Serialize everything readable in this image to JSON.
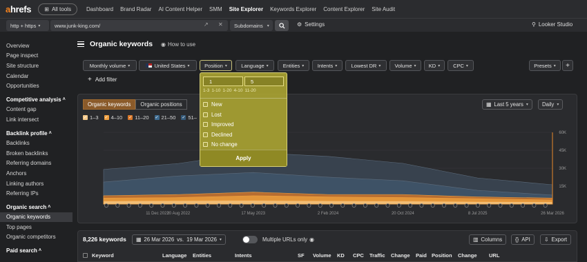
{
  "nav": {
    "logo_a": "a",
    "logo_rest": "hrefs",
    "all_tools": "All tools",
    "links": [
      "Dashboard",
      "Brand Radar",
      "AI Content Helper",
      "SMM",
      "Site Explorer",
      "Keywords Explorer",
      "Content Explorer",
      "Site Audit"
    ],
    "active": "Site Explorer"
  },
  "urlbar": {
    "protocol": "http + https",
    "url": "www.junk-king.com/",
    "mode": "Subdomains",
    "settings": "Settings",
    "looker": "Looker Studio"
  },
  "sidebar": {
    "items": [
      {
        "label": "Overview",
        "type": "item"
      },
      {
        "label": "Page inspect",
        "type": "item"
      },
      {
        "label": "Site structure",
        "type": "item"
      },
      {
        "label": "Calendar",
        "type": "item"
      },
      {
        "label": "Opportunities",
        "type": "item"
      },
      {
        "label": "Competitive analysis",
        "type": "head"
      },
      {
        "label": "Content gap",
        "type": "item"
      },
      {
        "label": "Link intersect",
        "type": "item"
      },
      {
        "label": "Backlink profile",
        "type": "head"
      },
      {
        "label": "Backlinks",
        "type": "item"
      },
      {
        "label": "Broken backlinks",
        "type": "item"
      },
      {
        "label": "Referring domains",
        "type": "item"
      },
      {
        "label": "Anchors",
        "type": "item"
      },
      {
        "label": "Linking authors",
        "type": "item"
      },
      {
        "label": "Referring IPs",
        "type": "item"
      },
      {
        "label": "Organic search",
        "type": "head"
      },
      {
        "label": "Organic keywords",
        "type": "active"
      },
      {
        "label": "Top pages",
        "type": "item"
      },
      {
        "label": "Organic competitors",
        "type": "item"
      },
      {
        "label": "Paid search",
        "type": "head"
      }
    ]
  },
  "page": {
    "title": "Organic keywords",
    "how_to": "How to use"
  },
  "filters": {
    "monthly_volume": "Monthly volume",
    "country": "United States",
    "position": "Position",
    "language": "Language",
    "entities": "Entities",
    "intents": "Intents",
    "lowest_dr": "Lowest DR",
    "volume": "Volume",
    "kd": "KD",
    "cpc": "CPC",
    "presets": "Presets",
    "plus": "+",
    "add_filter": "Add filter"
  },
  "position_dropdown": {
    "from_value": "1",
    "to_value": "5",
    "presets": [
      "1-3",
      "1-10",
      "1-20",
      "4-10",
      "11-20"
    ],
    "options": [
      "New",
      "Lost",
      "Improved",
      "Declined",
      "No change"
    ],
    "apply": "Apply"
  },
  "chart_panel": {
    "tab_keywords": "Organic keywords",
    "tab_positions": "Organic positions",
    "range": "Last 5 years",
    "granularity": "Daily",
    "legend": [
      {
        "label": "1–3",
        "color": "#f4c98a"
      },
      {
        "label": "4–10",
        "color": "#f0a040"
      },
      {
        "label": "11–20",
        "color": "#d9782a"
      },
      {
        "label": "21–50",
        "color": "#3d6a8f"
      },
      {
        "label": "51–",
        "color": "#355a7a"
      }
    ]
  },
  "chart_data": {
    "type": "area",
    "x": [
      "11 Dec 2021",
      "20 Aug 2022",
      "17 May 2023",
      "2 Feb 2024",
      "20 Oct 2024",
      "8 Jul 2025",
      "26 Mar 2026"
    ],
    "y_ticks": [
      "60K",
      "45K",
      "30K",
      "15K"
    ],
    "ylim": [
      0,
      60000
    ],
    "series": [
      {
        "name": "51–",
        "values": [
          29000,
          34000,
          43000,
          40000,
          34000,
          22000,
          16000
        ]
      },
      {
        "name": "21–50",
        "values": [
          19000,
          23000,
          27000,
          22000,
          20000,
          11000,
          8000
        ]
      },
      {
        "name": "11–20",
        "values": [
          7000,
          8000,
          10000,
          8000,
          8000,
          6000,
          5000
        ]
      },
      {
        "name": "4–10",
        "values": [
          5000,
          5500,
          7000,
          6000,
          5500,
          4500,
          3500
        ]
      },
      {
        "name": "1–3",
        "values": [
          2500,
          2800,
          3000,
          2600,
          2500,
          2000,
          1800
        ]
      }
    ]
  },
  "table_bar": {
    "keyword_count": "8,226 keywords",
    "date_a": "26 Mar 2026",
    "vs": "vs.",
    "date_b": "19 Mar 2026",
    "multiple_urls": "Multiple URLs only",
    "columns": "Columns",
    "api": "API",
    "export": "Export"
  },
  "table_headers": [
    "Keyword",
    "Language",
    "Entities",
    "Intents",
    "SF",
    "Volume",
    "KD",
    "CPC",
    "Traffic",
    "Change",
    "Paid",
    "Position",
    "Change",
    "URL"
  ]
}
